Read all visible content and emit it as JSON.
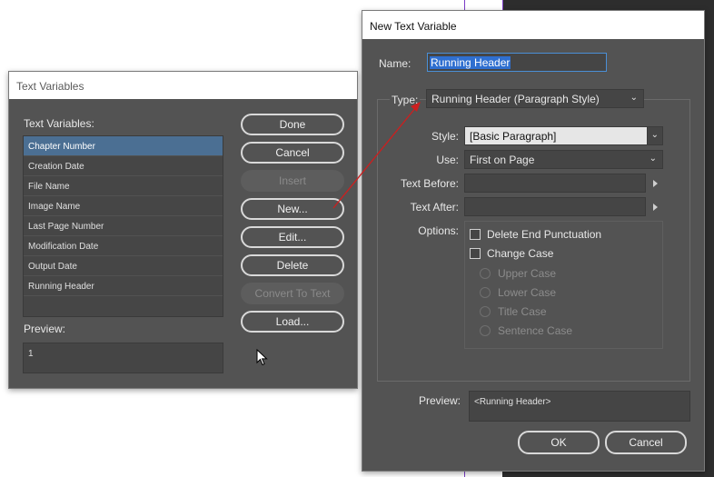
{
  "text_variables_dialog": {
    "title": "Text Variables",
    "list_label": "Text Variables:",
    "items": [
      "Chapter Number",
      "Creation Date",
      "File Name",
      "Image Name",
      "Last Page Number",
      "Modification Date",
      "Output Date",
      "Running Header"
    ],
    "selected_index": 0,
    "preview_label": "Preview:",
    "preview_value": "1",
    "buttons": {
      "done": "Done",
      "cancel": "Cancel",
      "insert": "Insert",
      "new": "New...",
      "edit": "Edit...",
      "delete": "Delete",
      "convert": "Convert To Text",
      "load": "Load..."
    }
  },
  "new_text_variable_dialog": {
    "title": "New Text Variable",
    "name_label": "Name:",
    "name_value": "Running Header",
    "type_label": "Type:",
    "type_value": "Running Header (Paragraph Style)",
    "style_label": "Style:",
    "style_value": "[Basic Paragraph]",
    "use_label": "Use:",
    "use_value": "First on Page",
    "text_before_label": "Text Before:",
    "text_before_value": "",
    "text_after_label": "Text After:",
    "text_after_value": "",
    "options_label": "Options:",
    "options": {
      "delete_end_punctuation": "Delete End Punctuation",
      "change_case": "Change Case",
      "cases": [
        "Upper Case",
        "Lower Case",
        "Title Case",
        "Sentence Case"
      ]
    },
    "preview_label": "Preview:",
    "preview_value": "<Running Header>",
    "buttons": {
      "ok": "OK",
      "cancel": "Cancel"
    }
  },
  "colors": {
    "dialog_bg": "#535353",
    "selection": "#4b6f93",
    "annotation_arrow": "#cc1f1f",
    "guide_line": "#7a3cc6"
  }
}
